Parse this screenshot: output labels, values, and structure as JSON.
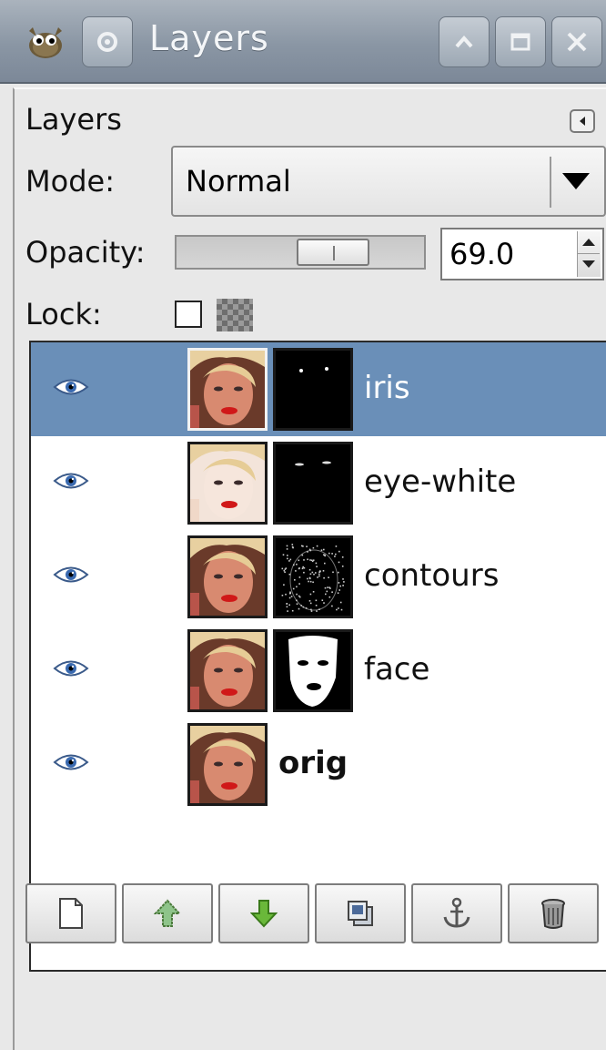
{
  "window": {
    "title": "Layers",
    "icons": [
      "gimp-wilber-icon",
      "pin-icon",
      "shade-up-icon",
      "maximize-icon",
      "close-icon"
    ]
  },
  "panel": {
    "tab_label": "Layers",
    "mode_label": "Mode:",
    "mode_value": "Normal",
    "opacity_label": "Opacity:",
    "opacity_value": "69.0",
    "opacity_fraction": 0.69,
    "lock_label": "Lock:"
  },
  "layers": [
    {
      "name": "iris",
      "visible": true,
      "selected": true,
      "has_mask": true,
      "bold": false
    },
    {
      "name": "eye-white",
      "visible": true,
      "selected": false,
      "has_mask": true,
      "bold": false
    },
    {
      "name": "contours",
      "visible": true,
      "selected": false,
      "has_mask": true,
      "bold": false
    },
    {
      "name": "face",
      "visible": true,
      "selected": false,
      "has_mask": true,
      "bold": false
    },
    {
      "name": "orig",
      "visible": true,
      "selected": false,
      "has_mask": false,
      "bold": true
    }
  ],
  "toolbar": {
    "buttons": [
      "new-layer-icon",
      "raise-layer-icon",
      "lower-layer-icon",
      "duplicate-layer-icon",
      "anchor-layer-icon",
      "delete-layer-icon"
    ]
  },
  "colors": {
    "selection": "#6a8fb8",
    "titlebar": "#8a96a4",
    "arrow_green": "#5a9a2a"
  }
}
